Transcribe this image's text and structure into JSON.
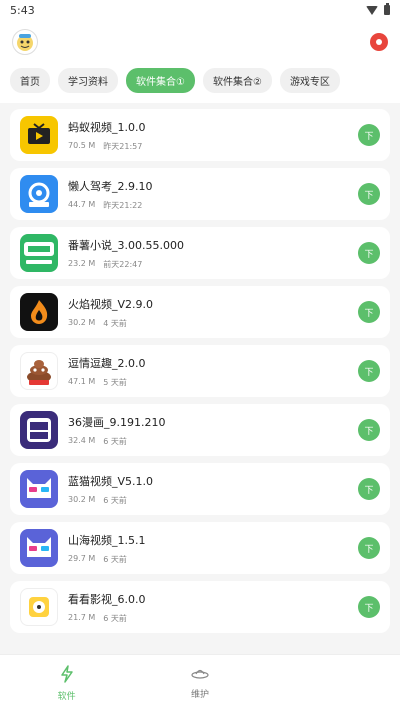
{
  "status": {
    "time": "5:43"
  },
  "tabs": [
    {
      "label": "首页"
    },
    {
      "label": "学习资料"
    },
    {
      "label": "软件集合①"
    },
    {
      "label": "软件集合②"
    },
    {
      "label": "游戏专区"
    }
  ],
  "apps": [
    {
      "name": "蚂蚁视频_1.0.0",
      "size": "70.5 M",
      "time": "昨天21:57",
      "icon": "tv-icon",
      "color": "#f7c600"
    },
    {
      "name": "懒人驾考_2.9.10",
      "size": "44.7 M",
      "time": "昨天21:22",
      "icon": "steering-wheel-icon",
      "color": "#2f8cf0"
    },
    {
      "name": "番薯小说_3.00.55.000",
      "size": "23.2 M",
      "time": "前天22:47",
      "icon": "free-novel-icon",
      "color": "#2fb765"
    },
    {
      "name": "火焰视频_V2.9.0",
      "size": "30.2 M",
      "time": "4 天前",
      "icon": "flame-icon",
      "color": "#111111"
    },
    {
      "name": "逗情逗趣_2.0.0",
      "size": "47.1 M",
      "time": "5 天前",
      "icon": "emoji-poop-icon",
      "color": "#ffffff"
    },
    {
      "name": "36漫画_9.191.210",
      "size": "32.4 M",
      "time": "6 天前",
      "icon": "comic-36-icon",
      "color": "#3a2c7a"
    },
    {
      "name": "蓝猫视频_V5.1.0",
      "size": "30.2 M",
      "time": "6 天前",
      "icon": "blue-cat-icon",
      "color": "#5a63d8"
    },
    {
      "name": "山海视频_1.5.1",
      "size": "29.7 M",
      "time": "6 天前",
      "icon": "cat-glasses-icon",
      "color": "#5a63d8"
    },
    {
      "name": "看看影视_6.0.0",
      "size": "21.7 M",
      "time": "6 天前",
      "icon": "film-reel-icon",
      "color": "#ffd23f"
    }
  ],
  "download_label": "下",
  "nav": [
    {
      "label": "软件",
      "icon": "bolt-icon"
    },
    {
      "label": "维护",
      "icon": "ufo-icon"
    }
  ]
}
